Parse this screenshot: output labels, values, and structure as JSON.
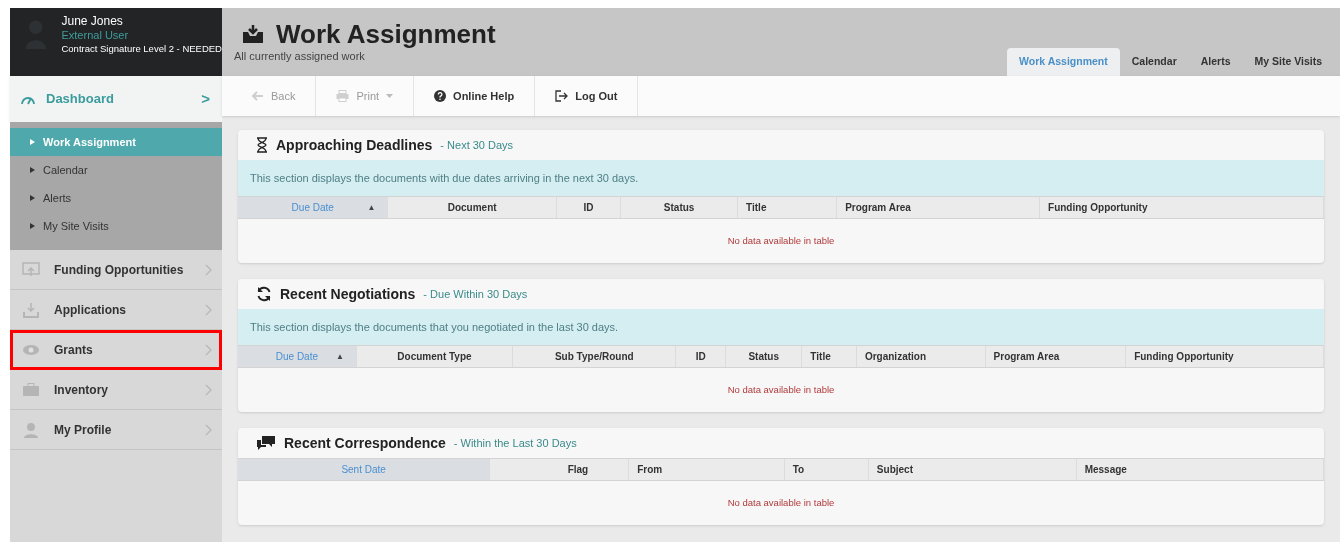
{
  "user": {
    "name": "June Jones",
    "role": "External User",
    "note": "Contract Signature Level 2 - NEEDED"
  },
  "dashboard": {
    "label": "Dashboard",
    "chevron": ">"
  },
  "sub_items": [
    {
      "label": "Work Assignment",
      "selected": true
    },
    {
      "label": "Calendar",
      "selected": false
    },
    {
      "label": "Alerts",
      "selected": false
    },
    {
      "label": "My Site Visits",
      "selected": false
    }
  ],
  "nav_items": [
    {
      "label": "Funding Opportunities",
      "highlighted": false
    },
    {
      "label": "Applications",
      "highlighted": false
    },
    {
      "label": "Grants",
      "highlighted": true
    },
    {
      "label": "Inventory",
      "highlighted": false
    },
    {
      "label": "My Profile",
      "highlighted": false
    }
  ],
  "page": {
    "title": "Work Assignment",
    "subtitle": "All currently assigned work"
  },
  "tabs": [
    {
      "label": "Work Assignment",
      "selected": true
    },
    {
      "label": "Calendar",
      "selected": false
    },
    {
      "label": "Alerts",
      "selected": false
    },
    {
      "label": "My Site Visits",
      "selected": false
    }
  ],
  "toolbar": [
    {
      "label": "Back",
      "disabled": true
    },
    {
      "label": "Print",
      "disabled": true
    },
    {
      "label": "Online Help",
      "disabled": false
    },
    {
      "label": "Log Out",
      "disabled": false
    }
  ],
  "sections": [
    {
      "title": "Approaching Deadlines",
      "subtitle": "- Next 30 Days",
      "info": "This section displays the documents with due dates arriving in the next 30 days.",
      "columns": [
        {
          "label": "Due Date",
          "sorted": true,
          "sort_icon": "▲"
        },
        {
          "label": "Document",
          "sorted": false
        },
        {
          "label": "ID",
          "sorted": false
        },
        {
          "label": "Status",
          "sorted": false
        },
        {
          "label": "Title",
          "sorted": false
        },
        {
          "label": "Program Area",
          "sorted": false
        },
        {
          "label": "Funding Opportunity",
          "sorted": false
        }
      ],
      "empty": "No data available in table"
    },
    {
      "title": "Recent Negotiations",
      "subtitle": "- Due Within 30 Days",
      "info": "This section displays the documents that you negotiated in the last 30 days.",
      "columns": [
        {
          "label": "Due Date",
          "sorted": true,
          "sort_icon": "▲"
        },
        {
          "label": "Document Type",
          "sorted": false
        },
        {
          "label": "Sub Type/Round",
          "sorted": false
        },
        {
          "label": "ID",
          "sorted": false
        },
        {
          "label": "Status",
          "sorted": false
        },
        {
          "label": "Title",
          "sorted": false
        },
        {
          "label": "Organization",
          "sorted": false
        },
        {
          "label": "Program Area",
          "sorted": false
        },
        {
          "label": "Funding Opportunity",
          "sorted": false
        }
      ],
      "empty": "No data available in table"
    },
    {
      "title": "Recent Correspondence",
      "subtitle": "- Within the Last 30 Days",
      "columns": [
        {
          "label": "Sent Date",
          "sorted": true
        },
        {
          "label": "Flag",
          "sorted": false
        },
        {
          "label": "From",
          "sorted": false
        },
        {
          "label": "To",
          "sorted": false
        },
        {
          "label": "Subject",
          "sorted": false
        },
        {
          "label": "Message",
          "sorted": false
        }
      ],
      "empty": "No data available in table"
    }
  ]
}
